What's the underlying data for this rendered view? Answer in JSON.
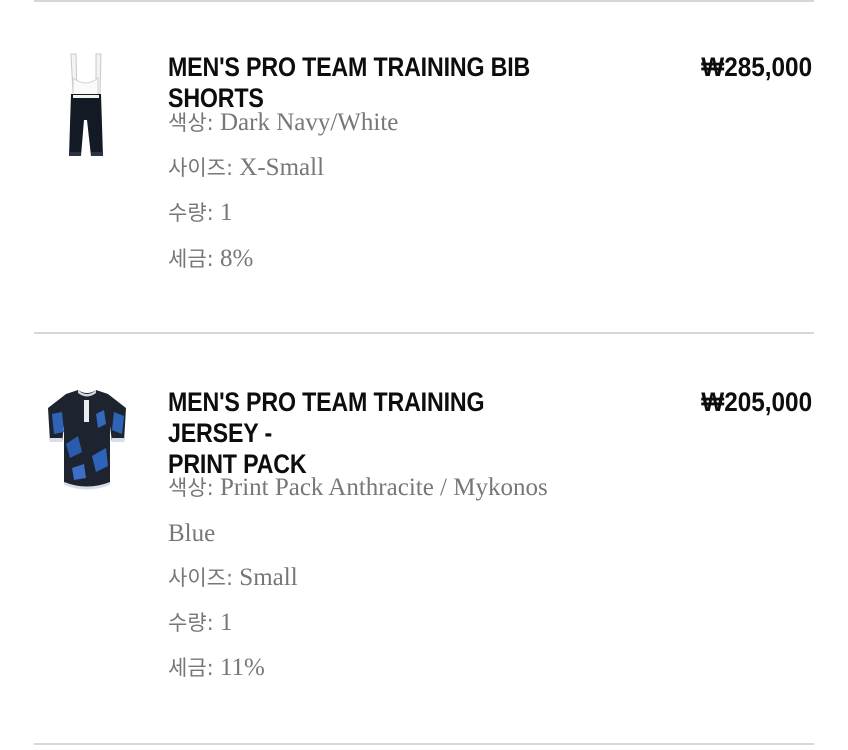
{
  "items": [
    {
      "title": "MEN'S PRO TEAM TRAINING BIB SHORTS",
      "price": "₩285,000",
      "image": "bib-shorts-icon",
      "attributes": [
        {
          "label": "색상:",
          "value": "Dark Navy/White"
        },
        {
          "label": "사이즈:",
          "value": "X-Small"
        },
        {
          "label": "수량:",
          "value": "1"
        },
        {
          "label": "세금:",
          "value": "8%"
        }
      ]
    },
    {
      "title_line1": "MEN'S PRO TEAM TRAINING JERSEY -",
      "title_line2": "PRINT PACK",
      "price": "₩205,000",
      "image": "jersey-icon",
      "attributes": [
        {
          "label": "색상:",
          "value_line1": "Print Pack Anthracite / Mykonos",
          "value_line2": "Blue"
        },
        {
          "label": "사이즈:",
          "value": "Small"
        },
        {
          "label": "수량:",
          "value": "1"
        },
        {
          "label": "세금:",
          "value": "11%"
        }
      ]
    }
  ],
  "colors": {
    "divider": "#d6d6d6",
    "title": "#0d0d0d",
    "attribute_text": "#777777"
  }
}
